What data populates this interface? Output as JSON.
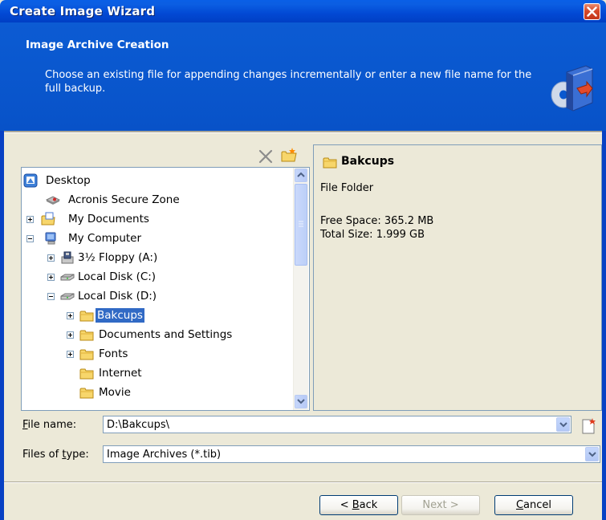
{
  "window": {
    "title": "Create Image Wizard"
  },
  "header": {
    "title": "Image Archive Creation",
    "description": "Choose an existing file for appending changes incrementally or enter a new file name for the full backup."
  },
  "tree": {
    "items": [
      {
        "label": "Desktop",
        "icon": "desktop-icon"
      },
      {
        "label": "Acronis Secure Zone",
        "icon": "secure-zone-icon"
      },
      {
        "label": "My Documents",
        "icon": "my-documents-icon"
      },
      {
        "label": "My Computer",
        "icon": "my-computer-icon"
      },
      {
        "label": "3½ Floppy (A:)",
        "icon": "floppy-drive-icon"
      },
      {
        "label": "Local Disk (C:)",
        "icon": "hard-disk-icon"
      },
      {
        "label": "Local Disk (D:)",
        "icon": "hard-disk-icon"
      },
      {
        "label": "Bakcups",
        "icon": "folder-icon",
        "selected": true
      },
      {
        "label": "Documents and Settings",
        "icon": "folder-icon"
      },
      {
        "label": "Fonts",
        "icon": "folder-icon"
      },
      {
        "label": "Internet",
        "icon": "folder-icon"
      },
      {
        "label": "Movie",
        "icon": "folder-icon"
      }
    ]
  },
  "info": {
    "name": "Bakcups",
    "type": "File Folder",
    "free_space": "Free Space: 365.2 MB",
    "total_size": "Total Size: 1.999 GB"
  },
  "file_name": {
    "label_prefix": "",
    "label_key": "F",
    "label_rest": "ile name:",
    "value": "D:\\Bakcups\\"
  },
  "file_type": {
    "label_prefix": "Files of ",
    "label_key": "t",
    "label_rest": "ype:",
    "value": "Image Archives (*.tib)"
  },
  "buttons": {
    "back_prefix": "< ",
    "back_key": "B",
    "back_rest": "ack",
    "next": "Next >",
    "cancel_key": "C",
    "cancel_rest": "ancel"
  },
  "colors": {
    "title_bar": "#0249d4",
    "header": "#0a58cf",
    "selection": "#316ac5",
    "panel": "#ece9d8"
  }
}
